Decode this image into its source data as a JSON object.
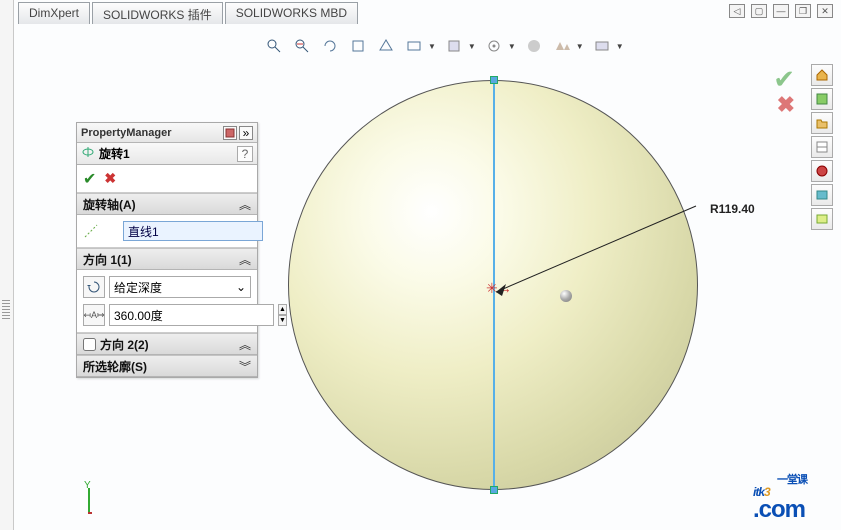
{
  "tabs": [
    "DimXpert",
    "SOLIDWORKS 插件",
    "SOLIDWORKS MBD"
  ],
  "panel": {
    "title": "PropertyManager",
    "feature_name": "旋转1",
    "sections": {
      "axis": {
        "title": "旋转轴(A)",
        "value": "直线1"
      },
      "direction1": {
        "title": "方向 1(1)",
        "type_label": "给定深度",
        "angle_value": "360.00度"
      },
      "direction2": {
        "title": "方向 2(2)",
        "checked": false
      },
      "contour": {
        "title": "所选轮廓(S)"
      }
    }
  },
  "viewport": {
    "radius_label": "R119.40"
  },
  "logo": {
    "main1": "itk",
    "main2": "3",
    "com": ".com",
    "sub": "一堂课"
  },
  "coord": {
    "y": "Y"
  }
}
